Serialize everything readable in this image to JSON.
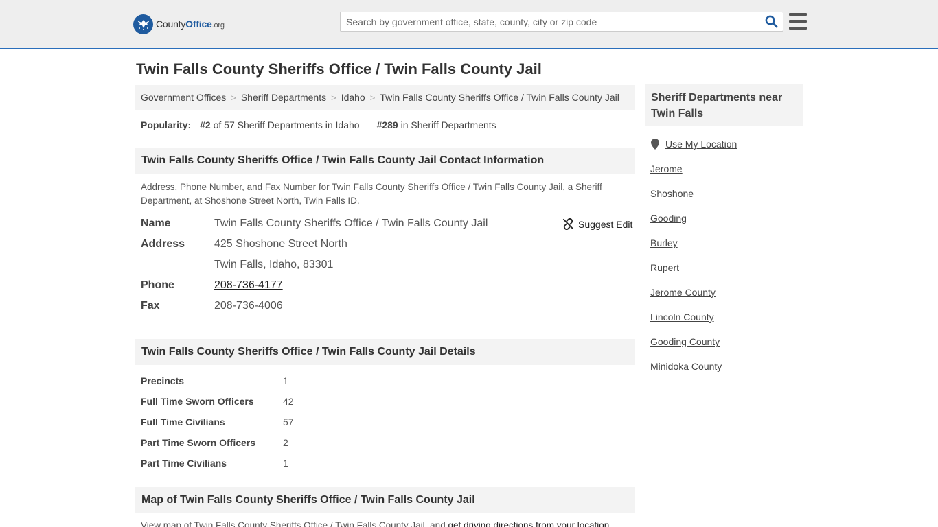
{
  "header": {
    "logo_county": "County",
    "logo_office": "Office",
    "logo_org": ".org",
    "search_placeholder": "Search by government office, state, county, city or zip code"
  },
  "page_title": "Twin Falls County Sheriffs Office / Twin Falls County Jail",
  "breadcrumb": [
    "Government Offices",
    "Sheriff Departments",
    "Idaho",
    "Twin Falls County Sheriffs Office / Twin Falls County Jail"
  ],
  "popularity": {
    "label": "Popularity:",
    "state_rank": "#2",
    "state_text": " of 57 Sheriff Departments in Idaho",
    "national_rank": "#289",
    "national_text": " in Sheriff Departments"
  },
  "contact": {
    "header": "Twin Falls County Sheriffs Office / Twin Falls County Jail Contact Information",
    "description": "Address, Phone Number, and Fax Number for Twin Falls County Sheriffs Office / Twin Falls County Jail, a Sheriff Department, at Shoshone Street North, Twin Falls ID.",
    "suggest_edit": "Suggest Edit",
    "name_label": "Name",
    "name_value": "Twin Falls County Sheriffs Office / Twin Falls County Jail",
    "address_label": "Address",
    "address_line1": "425 Shoshone Street North",
    "address_line2": "Twin Falls, Idaho, 83301",
    "phone_label": "Phone",
    "phone_value": "208-736-4177",
    "fax_label": "Fax",
    "fax_value": "208-736-4006"
  },
  "details": {
    "header": "Twin Falls County Sheriffs Office / Twin Falls County Jail Details",
    "rows": [
      {
        "label": "Precincts",
        "value": "1"
      },
      {
        "label": "Full Time Sworn Officers",
        "value": "42"
      },
      {
        "label": "Full Time Civilians",
        "value": "57"
      },
      {
        "label": "Part Time Sworn Officers",
        "value": "2"
      },
      {
        "label": "Part Time Civilians",
        "value": "1"
      }
    ]
  },
  "map": {
    "header": "Map of Twin Falls County Sheriffs Office / Twin Falls County Jail",
    "desc_prefix": "View map of Twin Falls County Sheriffs Office / Twin Falls County Jail, and ",
    "desc_link": "get driving directions from your location"
  },
  "sidebar": {
    "header": "Sheriff Departments near Twin Falls",
    "use_location": "Use My Location",
    "links": [
      "Jerome",
      "Shoshone",
      "Gooding",
      "Burley",
      "Rupert",
      "Jerome County",
      "Lincoln County",
      "Gooding County",
      "Minidoka County"
    ]
  },
  "colors": {
    "brand_blue": "#1f5b9f",
    "header_border": "#2a6ebb",
    "section_bg": "#f3f3f3"
  }
}
